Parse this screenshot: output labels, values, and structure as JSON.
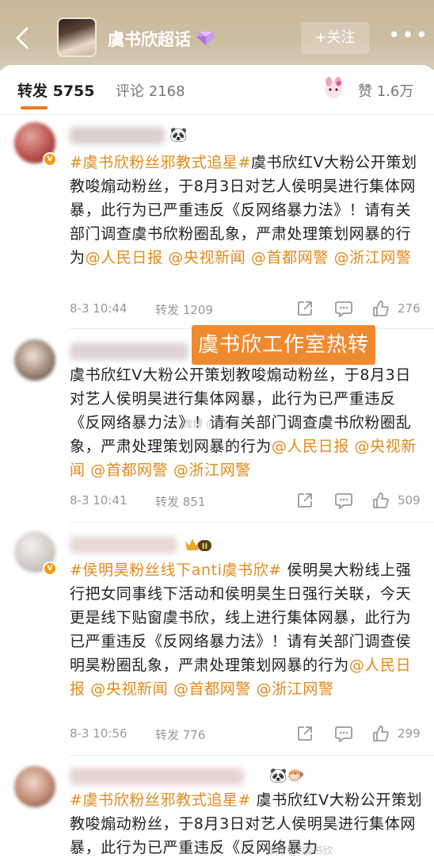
{
  "header": {
    "topic_title": "虞书欣超话",
    "follow_label": "+关注",
    "more_label": "•••"
  },
  "tabs": {
    "repost": "转发 5755",
    "comment": "评论 2168",
    "like": "赞 1.6万"
  },
  "overlay": {
    "studio_label": "虞书欣工作室热转",
    "watermark": "微博 @ 虞书欣"
  },
  "posts": [
    {
      "emoji": "🐼",
      "text_parts": [
        {
          "type": "tag",
          "text": "#虞书欣粉丝邪教式追星#"
        },
        {
          "type": "plain",
          "text": "虞书欣红Ⅴ大粉公开策划教唆煽动粉丝，于8月3日对艺人侯明昊进行集体网暴，此行为已严重违反《反网络暴力法》！请有关部门调查虞书欣粉圈乱象，严肃处理策划网暴的行为"
        },
        {
          "type": "at",
          "text": "@人民日报"
        },
        {
          "type": "plain",
          "text": " "
        },
        {
          "type": "at",
          "text": "@央视新闻"
        },
        {
          "type": "plain",
          "text": " "
        },
        {
          "type": "at",
          "text": "@首都网警"
        },
        {
          "type": "plain",
          "text": " "
        },
        {
          "type": "at",
          "text": "@浙江网警"
        }
      ],
      "time": "8-3 10:44",
      "repost": "转发 1209",
      "likes": "276"
    },
    {
      "text_parts": [
        {
          "type": "plain",
          "text": "虞书欣红Ⅴ大粉公开策划教唆煽动粉丝，于8月3日对艺人侯明昊进行集体网暴，此行为已严重违反《反网络暴力法》！请有关部门调查虞书欣粉圈乱象，严肃处理策划网暴的行为"
        },
        {
          "type": "at",
          "text": "@人民日报"
        },
        {
          "type": "plain",
          "text": " "
        },
        {
          "type": "at",
          "text": "@央视新闻"
        },
        {
          "type": "plain",
          "text": " "
        },
        {
          "type": "at",
          "text": "@首都网警"
        },
        {
          "type": "plain",
          "text": " "
        },
        {
          "type": "at",
          "text": "@浙江网警"
        }
      ],
      "time": "8-3 10:41",
      "repost": "转发 851",
      "likes": "509"
    },
    {
      "text_parts": [
        {
          "type": "tag",
          "text": "#侯明昊粉丝线下anti虞书欣#"
        },
        {
          "type": "plain",
          "text": " 侯明昊大粉线上强行把女同事线下活动和侯明昊生日强行关联，今天更是线下贴窗虞书欣，线上进行集体网暴，此行为已严重违反《反网络暴力法》！请有关部门调查侯明昊粉圈乱象，严肃处理策划网暴的行为"
        },
        {
          "type": "at",
          "text": "@人民日报"
        },
        {
          "type": "plain",
          "text": " "
        },
        {
          "type": "at",
          "text": "@央视新闻"
        },
        {
          "type": "plain",
          "text": " "
        },
        {
          "type": "at",
          "text": "@首都网警"
        },
        {
          "type": "plain",
          "text": " "
        },
        {
          "type": "at",
          "text": "@浙江网警"
        }
      ],
      "time": "8-3 10:56",
      "repost": "转发 776",
      "likes": "299"
    },
    {
      "emoji": "🐼🐡",
      "text_parts": [
        {
          "type": "tag",
          "text": "#虞书欣粉丝邪教式追星#"
        },
        {
          "type": "plain",
          "text": " 虞书欣红Ⅴ大粉公开策划教唆煽动粉丝，于8月3日对艺人侯明昊进行集体网暴，此行为已严重违反《反网络暴力"
        }
      ]
    }
  ],
  "colors": {
    "accent": "#e28a1b",
    "studio_bg": "#f08a2f",
    "header_bg": "#c9b79a"
  },
  "icons": [
    "back-icon",
    "gem-icon",
    "more-icon",
    "share-icon",
    "comment-icon",
    "like-icon",
    "v-badge-icon",
    "crown-badge-icon"
  ]
}
